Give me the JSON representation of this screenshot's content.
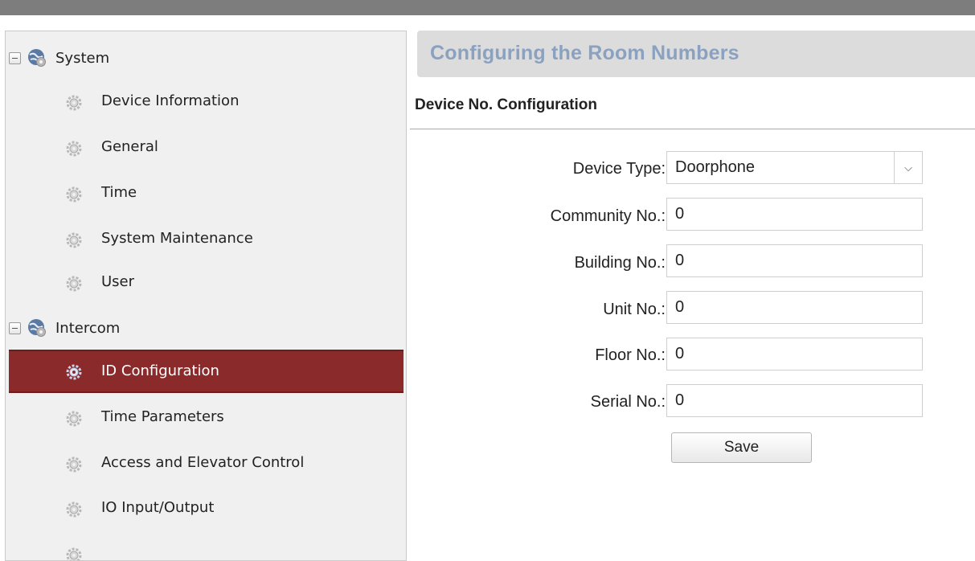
{
  "sidebar": {
    "groups": [
      {
        "label": "System",
        "items": [
          "Device Information",
          "General",
          "Time",
          "System Maintenance",
          "User"
        ]
      },
      {
        "label": "Intercom",
        "items": [
          "ID Configuration",
          "Time Parameters",
          "Access and Elevator Control",
          "IO Input/Output"
        ]
      }
    ],
    "active_item": "ID Configuration"
  },
  "main": {
    "title": "Configuring the Room Numbers",
    "section_title": "Device No. Configuration",
    "form": {
      "device_type": {
        "label": "Device Type:",
        "value": "Doorphone"
      },
      "community_no": {
        "label": "Community No.:",
        "value": "0"
      },
      "building_no": {
        "label": "Building No.:",
        "value": "0"
      },
      "unit_no": {
        "label": "Unit No.:",
        "value": "0"
      },
      "floor_no": {
        "label": "Floor No.:",
        "value": "0"
      },
      "serial_no": {
        "label": "Serial No.:",
        "value": "0"
      }
    },
    "save_label": "Save"
  },
  "colors": {
    "active_item_bg": "#8b2a2a",
    "title_color": "#8aa1c0",
    "title_bar_bg": "#dcdcdc"
  },
  "icons": {
    "group": "globe-icon",
    "item": "gear-icon",
    "toggle": "collapse-icon",
    "dropdown": "chevron-down-icon"
  }
}
